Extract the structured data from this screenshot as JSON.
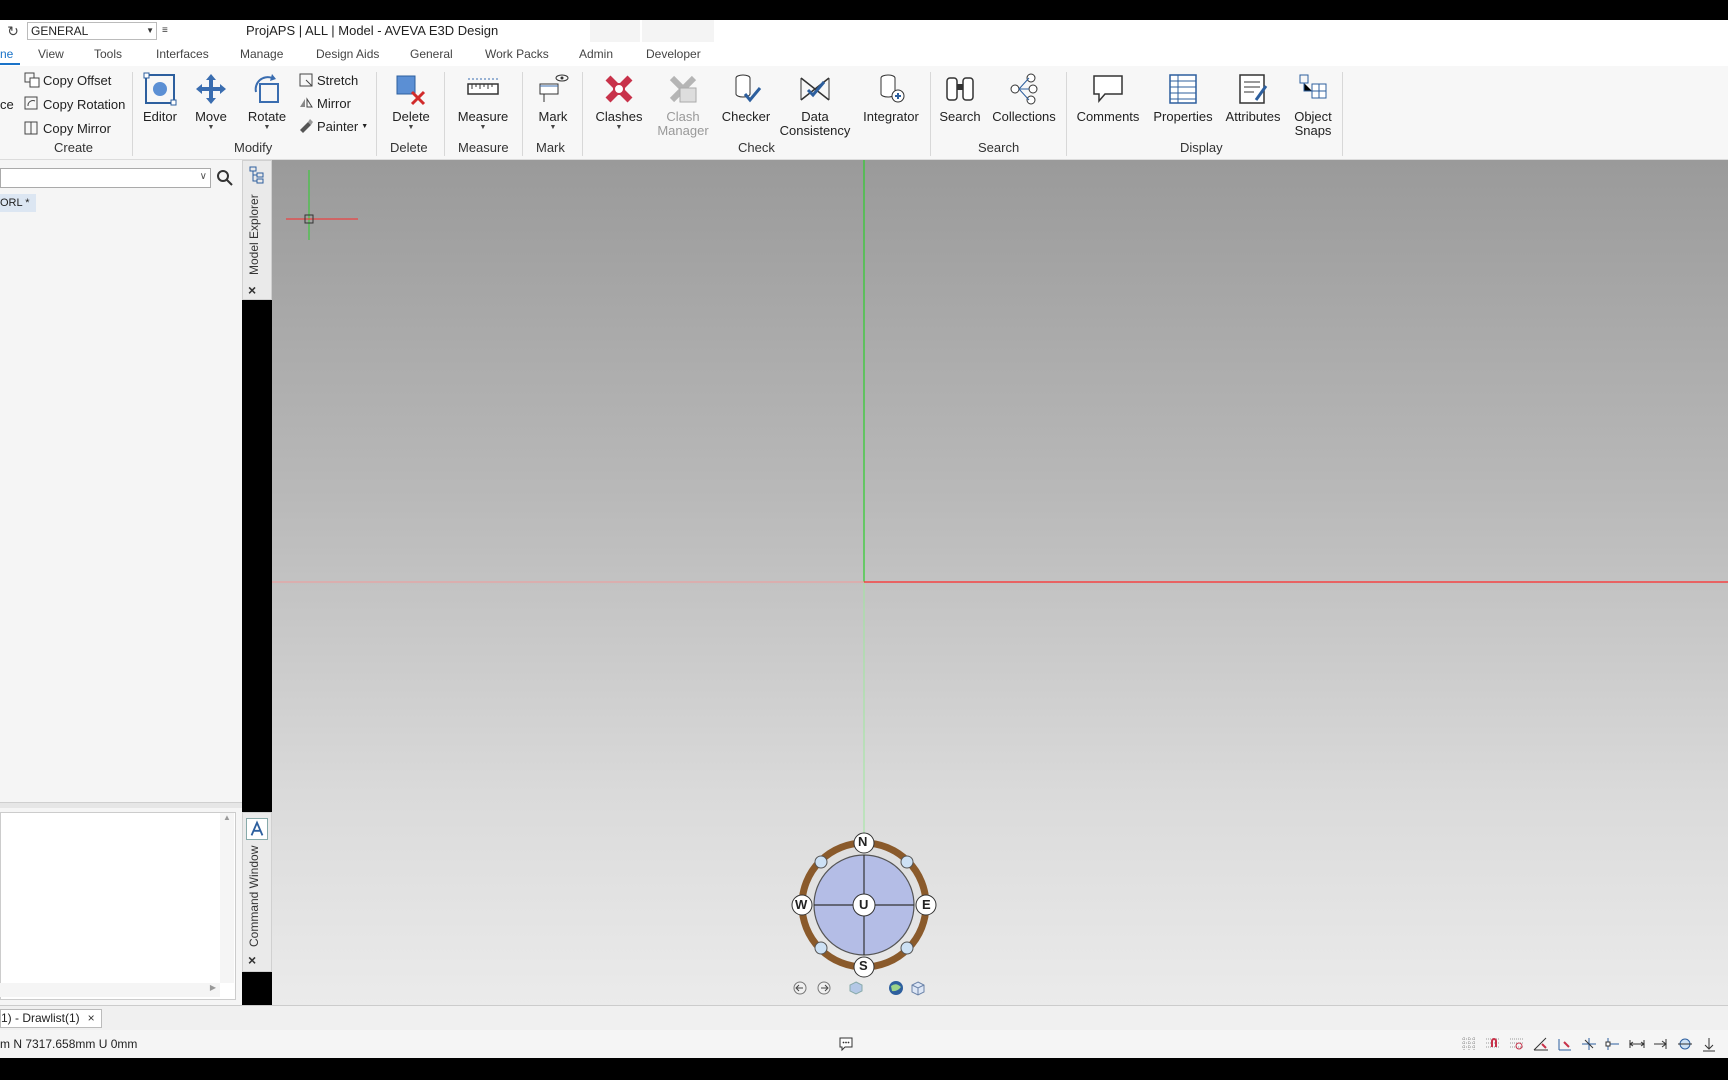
{
  "titlebar": {
    "module": "GENERAL",
    "window_title": "ProjAPS | ALL | Model - AVEVA E3D Design"
  },
  "tabs": [
    {
      "label": "ne",
      "active": true
    },
    {
      "label": "View"
    },
    {
      "label": "Tools"
    },
    {
      "label": "Interfaces"
    },
    {
      "label": "Manage"
    },
    {
      "label": "Design Aids"
    },
    {
      "label": "General"
    },
    {
      "label": "Work Packs"
    },
    {
      "label": "Admin"
    },
    {
      "label": "Developer"
    }
  ],
  "ribbon": {
    "create": {
      "cut_label": "ce",
      "copy_offset": "Copy Offset",
      "copy_rotation": "Copy Rotation",
      "copy_mirror": "Copy Mirror",
      "group": "Create"
    },
    "modify": {
      "editor": "Editor",
      "move": "Move",
      "rotate": "Rotate",
      "stretch": "Stretch",
      "mirror": "Mirror",
      "painter": "Painter",
      "group": "Modify"
    },
    "delete": {
      "button": "Delete",
      "group": "Delete"
    },
    "measure": {
      "button": "Measure",
      "group": "Measure"
    },
    "mark": {
      "button": "Mark",
      "group": "Mark"
    },
    "check": {
      "clashes": "Clashes",
      "clash_manager_1": "Clash",
      "clash_manager_2": "Manager",
      "checker": "Checker",
      "data_consistency_1": "Data",
      "data_consistency_2": "Consistency",
      "integrator": "Integrator",
      "group": "Check"
    },
    "search": {
      "search": "Search",
      "collections": "Collections",
      "group": "Search"
    },
    "display": {
      "comments": "Comments",
      "properties": "Properties",
      "attributes": "Attributes",
      "object_snaps_1": "Object",
      "object_snaps_2": "Snaps",
      "group": "Display"
    }
  },
  "explorer": {
    "search_value": "",
    "tree_root": "ORL *",
    "strip_label": "Model Explorer",
    "close": "×"
  },
  "command_window": {
    "strip_label": "Command Window",
    "close": "×"
  },
  "compass": {
    "n": "N",
    "s": "S",
    "e": "E",
    "w": "W",
    "u": "U"
  },
  "bottom_tabs": [
    {
      "label": "1) - Drawlist(1)",
      "close": "×"
    }
  ],
  "statusbar": {
    "coords": "m N 7317.658mm U 0mm"
  },
  "colors": {
    "x_axis": "#ff2a2a",
    "y_axis": "#2ccf2c",
    "accent": "#1a73c8",
    "compass_ring": "#8a5a2b",
    "compass_fill": "#b4bde6"
  }
}
